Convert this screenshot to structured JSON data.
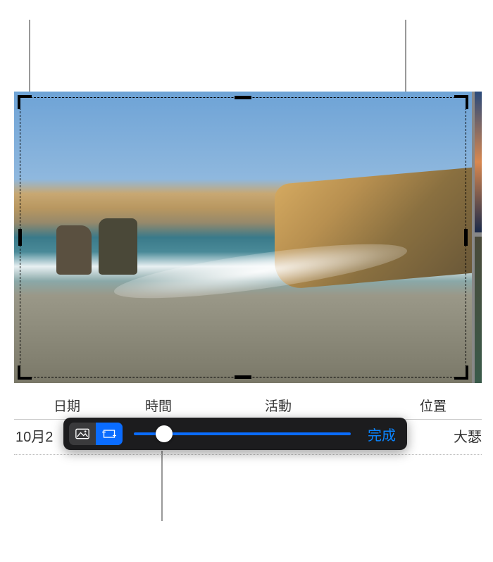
{
  "info": {
    "headers": {
      "date": "日期",
      "time": "時間",
      "event": "活動",
      "place": "位置"
    },
    "values": {
      "date": "10月2",
      "place": "大瑟"
    }
  },
  "toolbar": {
    "done_label": "完成",
    "slider_percent": 14
  },
  "icons": {
    "photo": "photo-icon",
    "crop": "crop-icon"
  }
}
